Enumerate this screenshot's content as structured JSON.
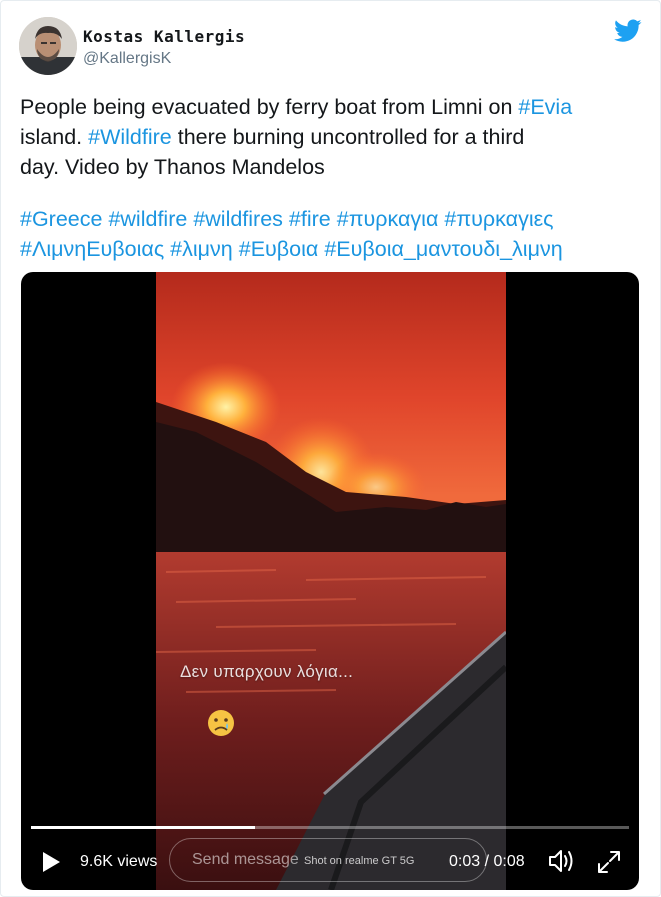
{
  "author": {
    "display_name": "Kostas Kallergis",
    "handle": "@KallergisK"
  },
  "tweet": {
    "line1_text": "People being evacuated by ferry boat from Limni on ",
    "line1_tag": "#Evia",
    "line2_tag": "#Wildfire",
    "line2_pre": "island. ",
    "line2_post": " there burning uncontrolled for a third",
    "line3_text": "day. Video by Thanos Mandelos",
    "hashtags_row1": [
      "#Greece",
      "#wildfire",
      "#wildfires",
      "#fire",
      "#πυρκαγια",
      "#πυρκαγιες"
    ],
    "hashtags_row2": [
      "#ΛιμνηΕυβοιας",
      "#λιμνη",
      "#Ευβοια",
      "#Ευβοια_μαντουδι_λιμνη"
    ]
  },
  "video": {
    "overlay_caption": "Δεν υπαρχουν λόγια...",
    "views": "9.6K views",
    "message_placeholder": "Send message",
    "watermark": "Shot on realme GT 5G",
    "current_time": "0:03",
    "time_separator": "/",
    "duration": "0:08",
    "progress": 0.375
  },
  "icons": {
    "brand": "twitter-bird-icon",
    "play": "play-icon",
    "volume": "volume-icon",
    "fullscreen": "expand-icon",
    "emoji": "sad-tear-emoji-icon"
  },
  "colors": {
    "link": "#1b95e0",
    "brand": "#1da1f2",
    "text": "#14171a",
    "muted": "#657786"
  }
}
